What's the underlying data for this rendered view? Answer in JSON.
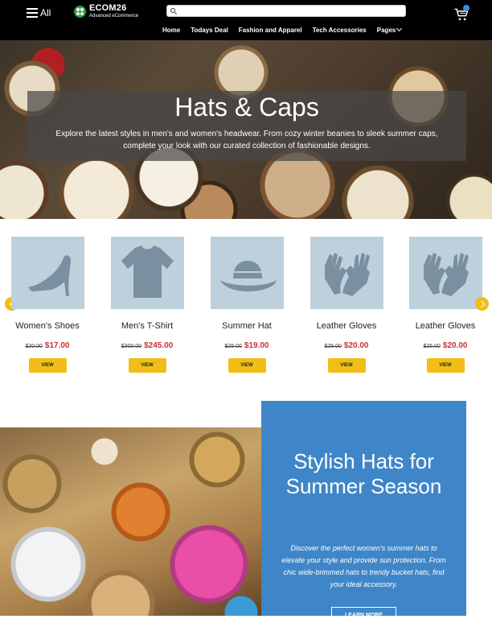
{
  "header": {
    "all_label": "All",
    "logo_title": "ECOM26",
    "logo_subtitle": "Advanced eCommerce",
    "search_placeholder": "",
    "nav": [
      "Home",
      "Todays Deal",
      "Fashion and Apparel",
      "Tech Accessories",
      "Pages"
    ],
    "cart_icon": "cart-icon",
    "cart_badge_color": "#3d8fd6"
  },
  "hero": {
    "title": "Hats & Caps",
    "text": "Explore the latest styles in men's and women's headwear. From cozy winter beanies to sleek summer caps, complete your look with our curated collection of fashionable designs."
  },
  "products": [
    {
      "name": "Women's Shoes",
      "old_price": "$20.00",
      "price": "$17.00",
      "icon": "high-heel-icon",
      "button": "VIEW"
    },
    {
      "name": "Men's T-Shirt",
      "old_price": "$300.00",
      "price": "$245.00",
      "icon": "tshirt-icon",
      "button": "VIEW"
    },
    {
      "name": "Summer Hat",
      "old_price": "$25.00",
      "price": "$19.00",
      "icon": "hat-icon",
      "button": "VIEW"
    },
    {
      "name": "Leather Gloves",
      "old_price": "$25.00",
      "price": "$20.00",
      "icon": "gloves-icon",
      "button": "VIEW"
    },
    {
      "name": "Leather Gloves",
      "old_price": "$25.00",
      "price": "$20.00",
      "icon": "gloves-icon",
      "button": "VIEW"
    }
  ],
  "carousel": {
    "prev_icon": "chevron-left-icon",
    "next_icon": "chevron-right-icon",
    "accent": "#f0be17"
  },
  "summer": {
    "title": "Stylish Hats for Summer Season",
    "text": "Discover the perfect women's summer hats to elevate your style and provide sun protection. From chic wide-brimmed hats to trendy bucket hats, find your ideal accessory.",
    "button": "LEARN MORE",
    "box_color": "#3f86c8"
  }
}
